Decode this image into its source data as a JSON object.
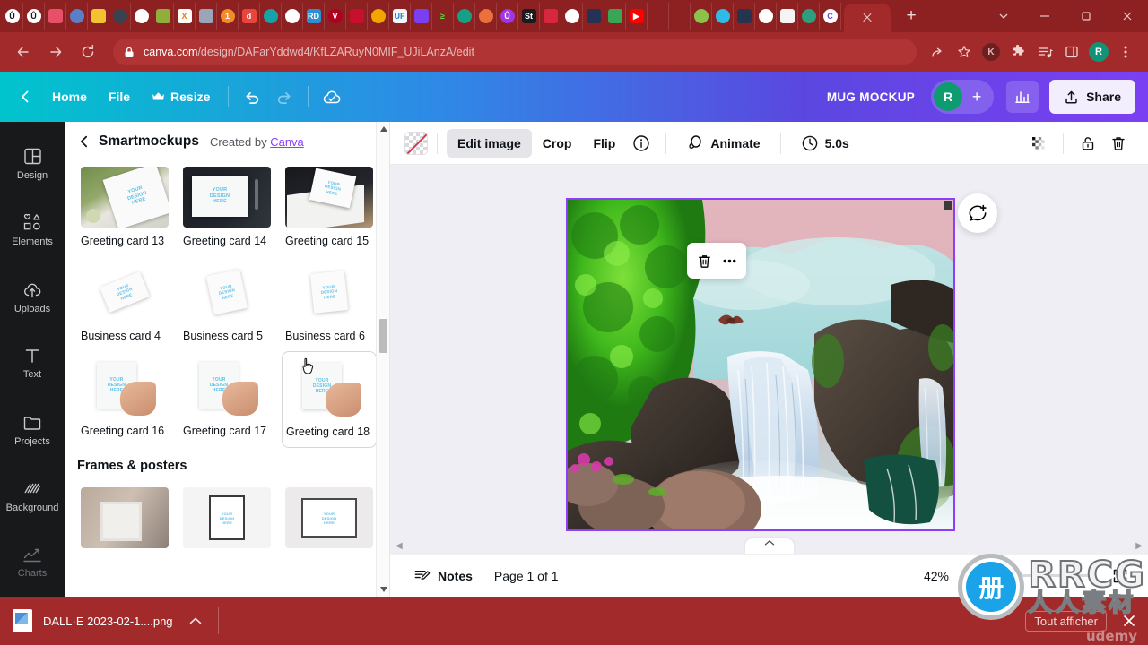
{
  "browser": {
    "bookmarks": [
      {
        "name": "bookmark-u1",
        "label": "Û",
        "bg": "#ffffff",
        "fg": "#1a1a1a",
        "shape": "circle"
      },
      {
        "name": "bookmark-u2",
        "label": "Û",
        "bg": "#ffffff",
        "fg": "#1a1a1a",
        "shape": "circle"
      },
      {
        "name": "bookmark-shop",
        "label": "",
        "bg": "#e8506a",
        "fg": "#ffffff",
        "shape": "sq"
      },
      {
        "name": "bookmark-grad",
        "label": "",
        "bg": "#5b7fc7",
        "fg": "#ffffff",
        "shape": "circle"
      },
      {
        "name": "bookmark-yellow",
        "label": "",
        "bg": "#f2c230",
        "fg": "#6b4a00",
        "shape": "sq"
      },
      {
        "name": "bookmark-dark-circle",
        "label": "",
        "bg": "#3a4252",
        "fg": "#ffffff",
        "shape": "circle"
      },
      {
        "name": "bookmark-globe-1",
        "label": "",
        "bg": "#ffffff",
        "fg": "#222222",
        "shape": "circle"
      },
      {
        "name": "bookmark-key",
        "label": "",
        "bg": "#8fae3c",
        "fg": "#ffffff",
        "shape": "sq"
      },
      {
        "name": "bookmark-excel",
        "label": "X",
        "bg": "#fdfdf5",
        "fg": "#e07b2a",
        "shape": "sq"
      },
      {
        "name": "bookmark-bag",
        "label": "",
        "bg": "#9aa6b8",
        "fg": "#ffffff",
        "shape": "sq"
      },
      {
        "name": "bookmark-one",
        "label": "1",
        "bg": "#f28c28",
        "fg": "#ffffff",
        "shape": "circle"
      },
      {
        "name": "bookmark-d",
        "label": "d",
        "bg": "#e8453c",
        "fg": "#ffffff",
        "shape": "sq"
      },
      {
        "name": "bookmark-ribbon",
        "label": "",
        "bg": "#17a2a8",
        "fg": "#ffffff",
        "shape": "circle"
      },
      {
        "name": "bookmark-globe-2",
        "label": "",
        "bg": "#ffffff",
        "fg": "#222222",
        "shape": "circle"
      },
      {
        "name": "bookmark-rd",
        "label": "RD",
        "bg": "#2b8fd6",
        "fg": "#ffffff",
        "shape": "sq"
      },
      {
        "name": "bookmark-v",
        "label": "V",
        "bg": "#b00020",
        "fg": "#ffffff",
        "shape": "circle"
      },
      {
        "name": "bookmark-dragon",
        "label": "",
        "bg": "#c8102e",
        "fg": "#ffffff",
        "shape": "sq"
      },
      {
        "name": "bookmark-medal",
        "label": "",
        "bg": "#f0a500",
        "fg": "#ffffff",
        "shape": "circle"
      },
      {
        "name": "bookmark-uf",
        "label": "UF",
        "bg": "#f4f6fb",
        "fg": "#2a7fc4",
        "shape": "sq"
      },
      {
        "name": "bookmark-faded",
        "label": "",
        "bg": "#7b3ff2",
        "fg": "#ffffff",
        "shape": "sq"
      },
      {
        "name": "bookmark-chev",
        "label": "≥",
        "bg": "#8d2020",
        "fg": "#5ad83c",
        "shape": "sq"
      },
      {
        "name": "bookmark-green-circle",
        "label": "",
        "bg": "#16a085",
        "fg": "#ffffff",
        "shape": "circle"
      },
      {
        "name": "bookmark-orange-circle",
        "label": "",
        "bg": "#e8713c",
        "fg": "#ffffff",
        "shape": "circle"
      },
      {
        "name": "bookmark-purple-u",
        "label": "Û",
        "bg": "#a335e8",
        "fg": "#ffffff",
        "shape": "circle"
      },
      {
        "name": "bookmark-st",
        "label": "St",
        "bg": "#1b1b1f",
        "fg": "#ffffff",
        "shape": "sq"
      },
      {
        "name": "bookmark-red-sq",
        "label": "",
        "bg": "#d7263d",
        "fg": "#ffffff",
        "shape": "sq"
      },
      {
        "name": "bookmark-globe-3",
        "label": "",
        "bg": "#ffffff",
        "fg": "#222222",
        "shape": "circle"
      },
      {
        "name": "bookmark-watch",
        "label": "",
        "bg": "#253255",
        "fg": "#ffffff",
        "shape": "sq"
      },
      {
        "name": "bookmark-rainbow",
        "label": "",
        "bg": "#3aa655",
        "fg": "#ffffff",
        "shape": "sq"
      },
      {
        "name": "bookmark-youtube",
        "label": "▶",
        "bg": "#ff0000",
        "fg": "#ffffff",
        "shape": "sq"
      },
      {
        "name": "bookmark-drop",
        "label": "",
        "bg": "#8d2020",
        "fg": "#f05a28",
        "shape": "circle"
      },
      {
        "name": "bookmark-figma",
        "label": "",
        "bg": "#8d2020",
        "fg": "#f24e1e",
        "shape": "sq"
      },
      {
        "name": "bookmark-leaf",
        "label": "",
        "bg": "#8bc34a",
        "fg": "#ffffff",
        "shape": "circle"
      },
      {
        "name": "bookmark-evernote",
        "label": "",
        "bg": "#2dbbe8",
        "fg": "#ffffff",
        "shape": "circle"
      },
      {
        "name": "bookmark-dark-app",
        "label": "",
        "bg": "#27344f",
        "fg": "#ffffff",
        "shape": "sq"
      },
      {
        "name": "bookmark-chatgpt",
        "label": "",
        "bg": "#ffffff",
        "fg": "#10a37f",
        "shape": "circle"
      },
      {
        "name": "bookmark-white-doc",
        "label": "",
        "bg": "#f4f4f4",
        "fg": "#555555",
        "shape": "sq"
      },
      {
        "name": "bookmark-spiral",
        "label": "",
        "bg": "#2f9e7e",
        "fg": "#ffffff",
        "shape": "circle"
      },
      {
        "name": "bookmark-c",
        "label": "C",
        "bg": "#ffffff",
        "fg": "#6a3fd8",
        "shape": "circle"
      }
    ],
    "url_domain": "canva.com",
    "url_path": "/design/DAFarYddwd4/KfLZARuyN0MIF_UJiLAnzA/edit",
    "profile_initial": "R",
    "extension_initial": "K"
  },
  "canva_header": {
    "home_label": "Home",
    "file_label": "File",
    "resize_label": "Resize",
    "doc_title": "MUG MOCKUP",
    "avatar_initial": "R",
    "share_label": "Share"
  },
  "rail": {
    "items": [
      {
        "label": "Design",
        "icon": "design-icon"
      },
      {
        "label": "Elements",
        "icon": "elements-icon"
      },
      {
        "label": "Uploads",
        "icon": "uploads-icon"
      },
      {
        "label": "Text",
        "icon": "text-icon"
      },
      {
        "label": "Projects",
        "icon": "projects-icon"
      },
      {
        "label": "Background",
        "icon": "background-icon"
      },
      {
        "label": "Charts",
        "icon": "charts-icon"
      }
    ]
  },
  "panel": {
    "title": "Smartmockups",
    "created_by": "Created by",
    "creator_link": "Canva",
    "placeholder_text": "YOUR DESIGN HERE",
    "row1": [
      {
        "caption": "Greeting card 13",
        "style": "photo-nature"
      },
      {
        "caption": "Greeting card 14",
        "style": "photo-desk"
      },
      {
        "caption": "Greeting card 15",
        "style": "photo-box"
      }
    ],
    "row2": [
      {
        "caption": "Business card 4",
        "style": "flat-card-a"
      },
      {
        "caption": "Business card 5",
        "style": "flat-card-b"
      },
      {
        "caption": "Business card 6",
        "style": "flat-card-c"
      }
    ],
    "row3": [
      {
        "caption": "Greeting card 16",
        "style": "hand-card",
        "selected": false
      },
      {
        "caption": "Greeting card 17",
        "style": "hand-card",
        "selected": false
      },
      {
        "caption": "Greeting card 18",
        "style": "hand-card",
        "selected": true
      }
    ],
    "section_title": "Frames & posters",
    "row4": [
      {
        "caption": "",
        "style": "frame-wall"
      },
      {
        "caption": "",
        "style": "frame-plain"
      },
      {
        "caption": "",
        "style": "frame-poster"
      }
    ]
  },
  "context_bar": {
    "edit_image": "Edit image",
    "crop": "Crop",
    "flip": "Flip",
    "info_icon": "info-icon",
    "animate": "Animate",
    "duration": "5.0s",
    "transparency_icon": "transparency-icon",
    "lock_icon": "lock-icon",
    "delete_icon": "delete-icon"
  },
  "canvas": {
    "float_tools": [
      "lock-icon",
      "duplicate-icon",
      "add-page-icon"
    ],
    "element_menu": [
      "trash-icon",
      "more-options-icon"
    ],
    "comment_icon": "add-comment-icon"
  },
  "status_bar": {
    "notes_label": "Notes",
    "page_label": "Page 1 of 1",
    "zoom_level": "42%",
    "fit_icon": "fit-screen-icon"
  },
  "watermark": {
    "brand": "RRCG",
    "brand_cn": "人人素材",
    "badge_glyph": "册"
  },
  "download_bar": {
    "filename": "DALL·E 2023-02-1....png",
    "show_all": "Tout afficher",
    "close_icon": "close-icon",
    "udemy": "udemy"
  },
  "colors": {
    "browser_red": "#a32a2a",
    "browser_red_dark": "#8d2020",
    "canva_purple": "#8b3ffd",
    "canvas_bg": "#efeef4",
    "accent_teal": "#00c4cc"
  }
}
